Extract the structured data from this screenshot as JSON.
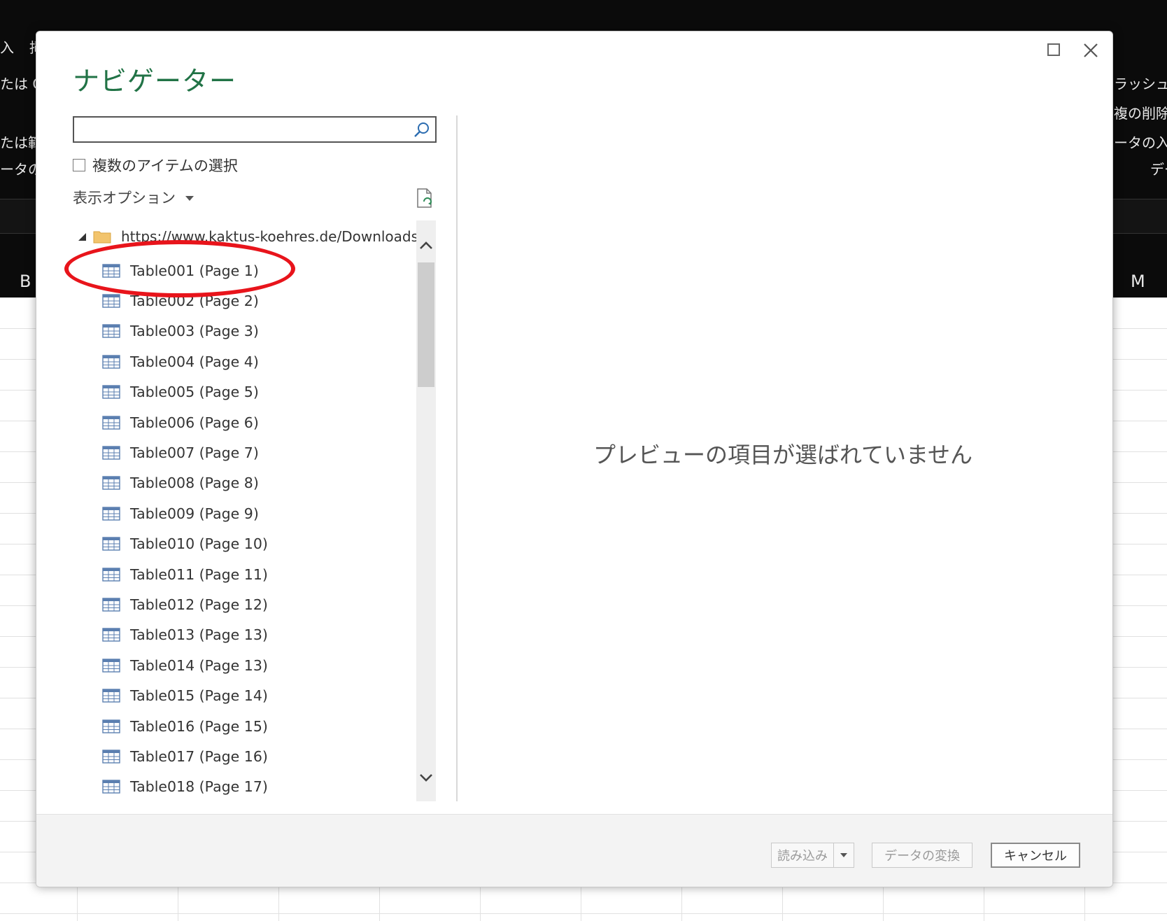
{
  "background": {
    "left_fragments": [
      "入",
      "挿",
      "たは C",
      "たは範",
      "ータの"
    ],
    "right_fragments": [
      "ラッシュ フ",
      "複の削除",
      "ータの入力",
      "デー"
    ],
    "column_headers": [
      "B",
      "M"
    ]
  },
  "dialog": {
    "title": "ナビゲーター",
    "search": {
      "value": "",
      "placeholder": ""
    },
    "multi_select_label": "複数のアイテムの選択",
    "display_options_label": "表示オプション",
    "tree": {
      "root_label": "https://www.kaktus-koehres.de/Downloads...",
      "items": [
        "Table001 (Page 1)",
        "Table002 (Page 2)",
        "Table003 (Page 3)",
        "Table004 (Page 4)",
        "Table005 (Page 5)",
        "Table006 (Page 6)",
        "Table007 (Page 7)",
        "Table008 (Page 8)",
        "Table009 (Page 9)",
        "Table010 (Page 10)",
        "Table011 (Page 11)",
        "Table012 (Page 12)",
        "Table013 (Page 13)",
        "Table014 (Page 13)",
        "Table015 (Page 14)",
        "Table016 (Page 15)",
        "Table017 (Page 16)",
        "Table018 (Page 17)"
      ]
    },
    "preview_empty_text": "プレビューの項目が選ばれていません",
    "footer": {
      "load_label": "読み込み",
      "transform_label": "データの変換",
      "cancel_label": "キャンセル"
    }
  },
  "colors": {
    "title_green": "#217346",
    "highlight_red": "#e8141b",
    "table_icon_blue": "#2b6cb0"
  },
  "icons": [
    "maximize-icon",
    "close-icon",
    "search-icon",
    "refresh-icon",
    "folder-icon",
    "table-icon",
    "chevron-up-icon",
    "chevron-down-icon"
  ]
}
